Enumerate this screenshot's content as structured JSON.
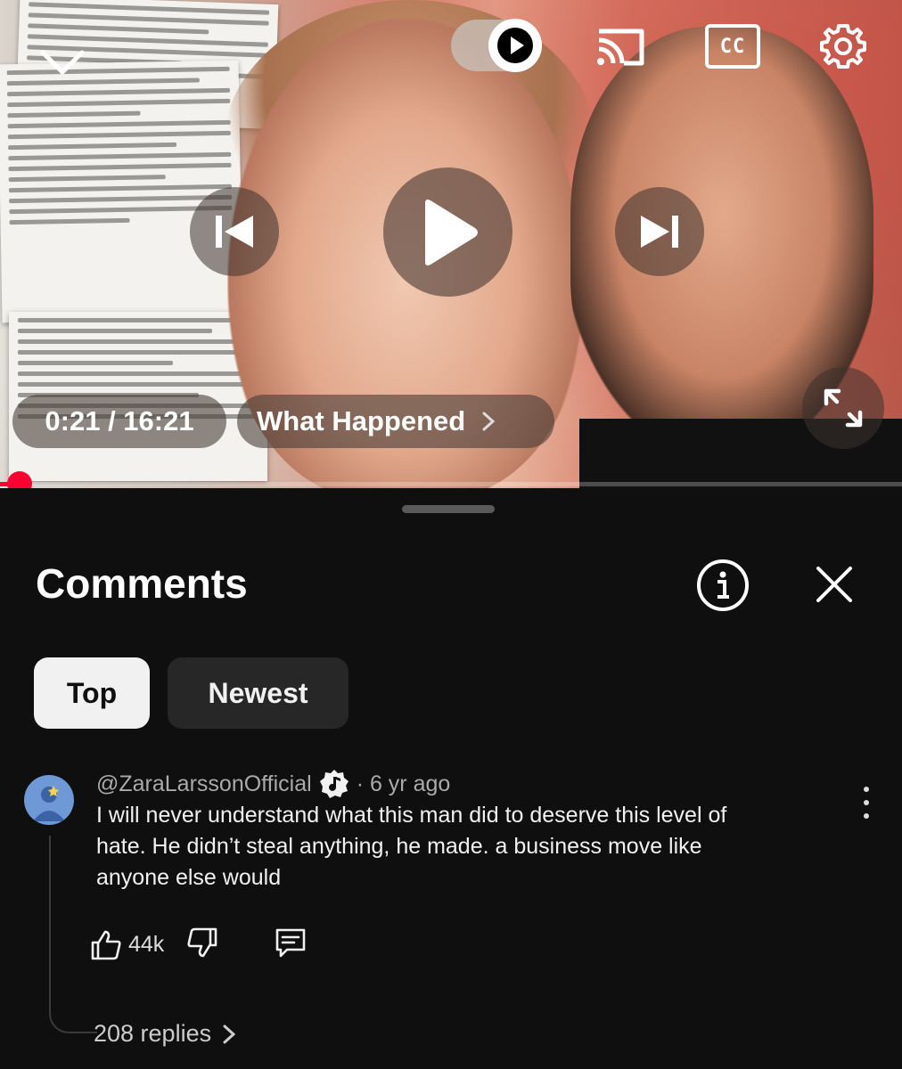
{
  "player": {
    "time": "0:21 / 16:21",
    "chapter": "What Happened",
    "progress_fraction": 0.0216,
    "icons": {
      "collapse": "chevron-down-icon",
      "autoplay": "autoplay-toggle-icon",
      "cast": "cast-icon",
      "captions": "cc-icon",
      "settings": "gear-icon",
      "previous": "skip-previous-icon",
      "play": "play-icon",
      "next": "skip-next-icon",
      "fullscreen": "fullscreen-icon"
    },
    "captions_label": "CC",
    "accent_color": "#ff0033"
  },
  "comments": {
    "title": "Comments",
    "tabs": [
      {
        "label": "Top",
        "selected": true
      },
      {
        "label": "Newest",
        "selected": false
      }
    ],
    "items": [
      {
        "author": "@ZaraLarssonOfficial",
        "age": "· 6 yr ago",
        "text": "I will never understand what this man did to deserve this level of hate. He didn’t steal anything, he made. a business move like anyone else would",
        "likes": "44k",
        "replies": "208 replies"
      }
    ]
  }
}
